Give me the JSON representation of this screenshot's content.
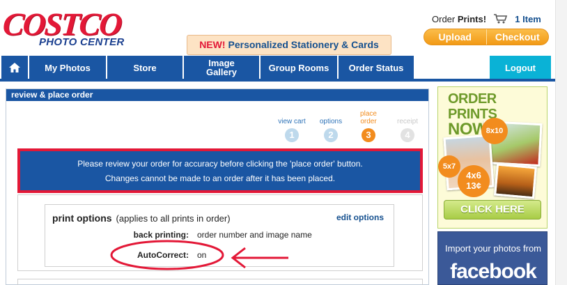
{
  "brand": {
    "logo_top": "COSTCO",
    "logo_bottom": "PHOTO CENTER"
  },
  "promo": {
    "new": "NEW!",
    "text": "Personalized Stationery & Cards"
  },
  "cart": {
    "prefix": "Order",
    "prints": "Prints!",
    "count": "1 Item"
  },
  "actions": {
    "upload": "Upload",
    "checkout": "Checkout"
  },
  "nav": {
    "home_icon": "home-icon",
    "items": [
      "My Photos",
      "Store",
      "Image Gallery",
      "Group Rooms",
      "Order Status"
    ],
    "logout": "Logout"
  },
  "panel": {
    "title": "review & place order"
  },
  "steps": [
    {
      "label": "view cart",
      "num": "1",
      "state": "done"
    },
    {
      "label": "options",
      "num": "2",
      "state": "done"
    },
    {
      "label": "place order",
      "num": "3",
      "state": "active"
    },
    {
      "label": "receipt",
      "num": "4",
      "state": "disabled"
    }
  ],
  "alert": {
    "line1": "Please review your order for accuracy before clicking the 'place order' button.",
    "line2": "Changes cannot be made to an order after it has been placed."
  },
  "print_options": {
    "title": "print options",
    "note": "(applies to all prints in order)",
    "edit": "edit options",
    "rows": [
      {
        "key": "back printing:",
        "value": "order number and image name"
      },
      {
        "key": "AutoCorrect:",
        "value": "on"
      }
    ]
  },
  "ads": {
    "order_line1": "ORDER PRINTS",
    "order_line2": "NOW",
    "badge_8x10": "8x10",
    "badge_5x7": "5x7",
    "badge_4x6": "4x6",
    "badge_price": "13¢",
    "click": "CLICK HERE",
    "fb_line": "Import your photos from",
    "fb_word": "facebook"
  },
  "colors": {
    "brand_red": "#e31837",
    "nav_blue": "#1a56a3",
    "logout_cyan": "#0ab2d6",
    "accent_orange": "#f28c1e"
  }
}
